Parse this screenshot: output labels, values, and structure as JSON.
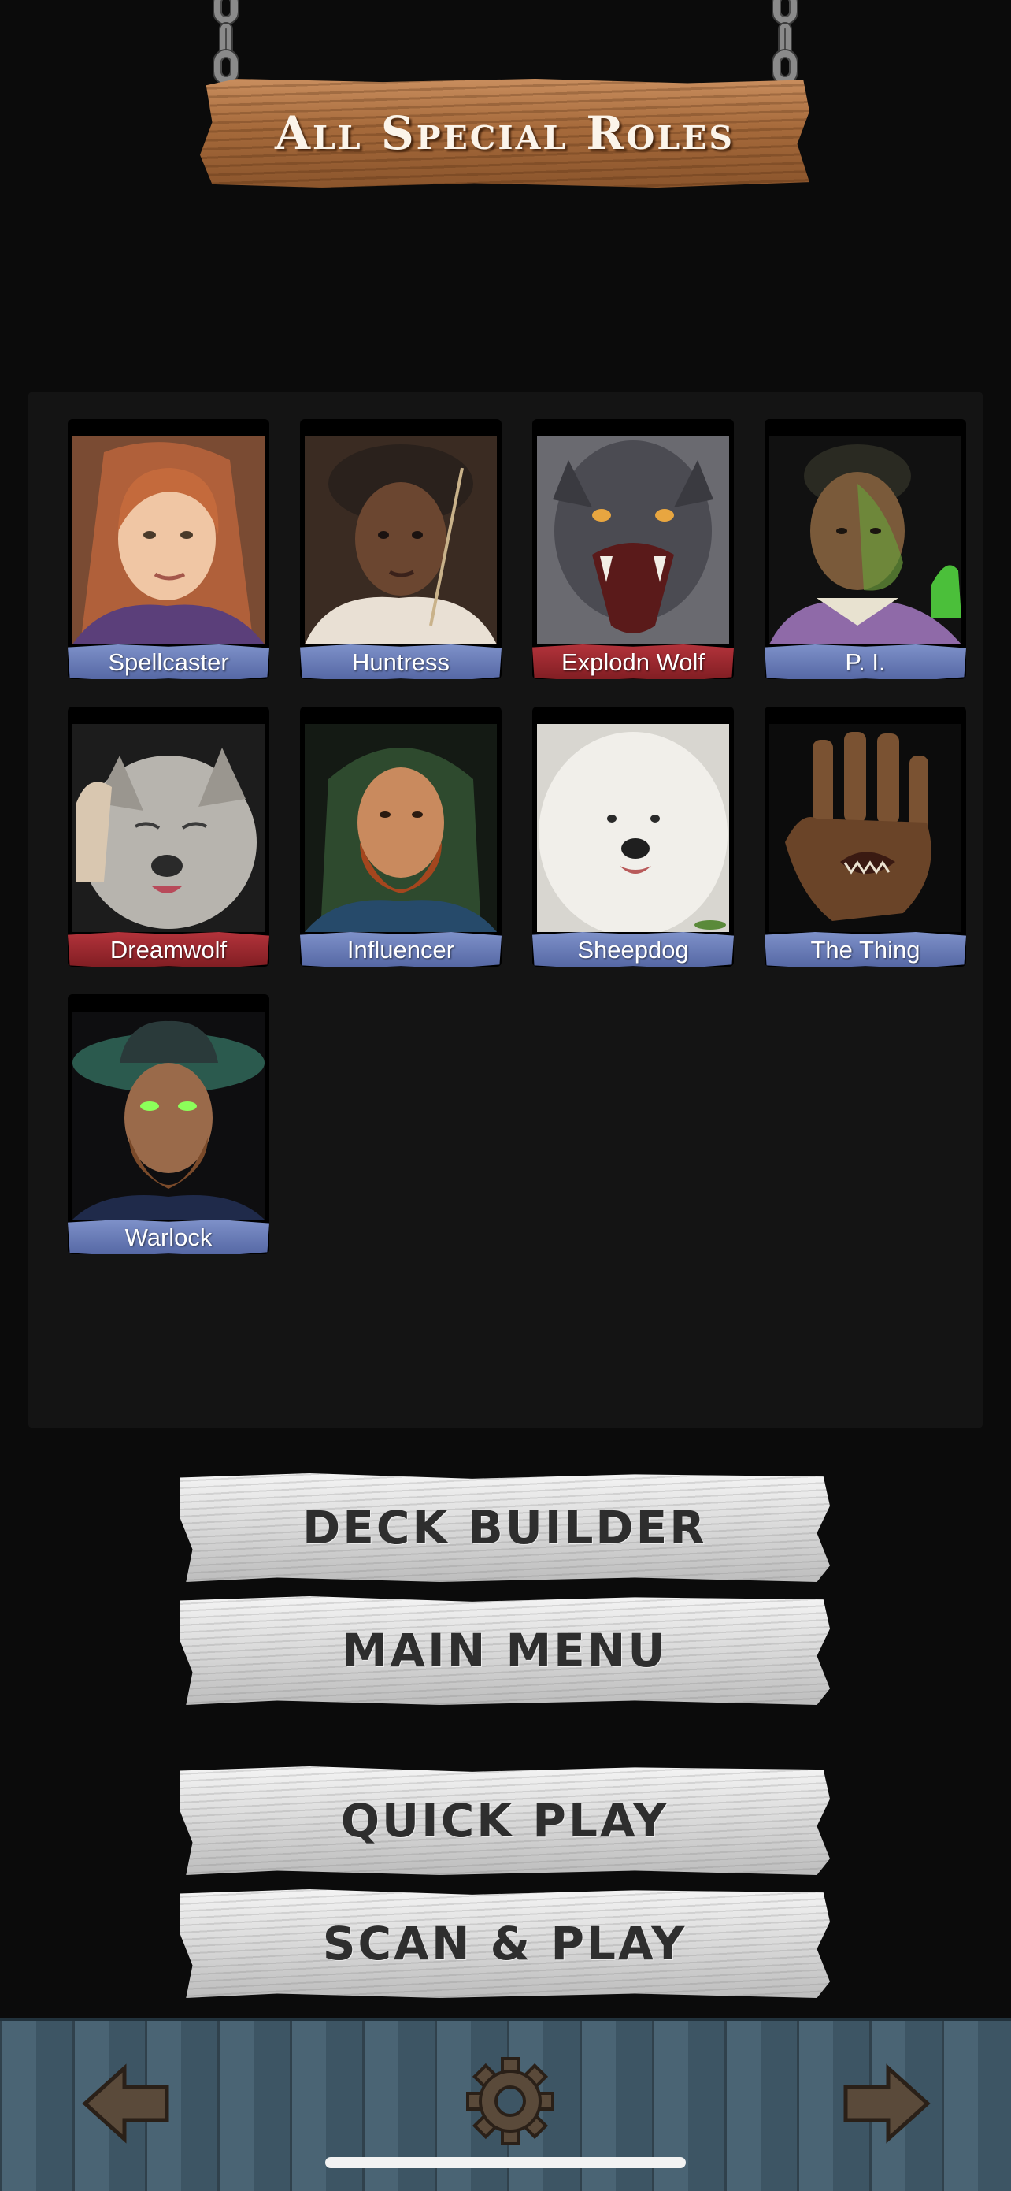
{
  "header": {
    "title": "All Special Roles"
  },
  "roles": [
    {
      "name": "Spellcaster",
      "team": "villager"
    },
    {
      "name": "Huntress",
      "team": "villager"
    },
    {
      "name": "Explodn Wolf",
      "team": "wolf"
    },
    {
      "name": "P. I.",
      "team": "villager"
    },
    {
      "name": "Dreamwolf",
      "team": "wolf"
    },
    {
      "name": "Influencer",
      "team": "villager"
    },
    {
      "name": "Sheepdog",
      "team": "villager"
    },
    {
      "name": "The Thing",
      "team": "villager"
    },
    {
      "name": "Warlock",
      "team": "villager"
    }
  ],
  "menu": {
    "deck_builder": "DECK BUILDER",
    "main_menu": "MAIN MENU",
    "quick_play": "QUICK PLAY",
    "scan_play": "SCAN & PLAY"
  },
  "toolbar": {
    "back_icon": "arrow-left-icon",
    "settings_icon": "gear-icon",
    "forward_icon": "arrow-right-icon"
  },
  "colors": {
    "villager_banner": "#5f72ad",
    "wolf_banner": "#9b2630",
    "title_wood": "#a66a3b",
    "plank": "#dcdcdc",
    "bottom_wood": "#4a6474"
  }
}
